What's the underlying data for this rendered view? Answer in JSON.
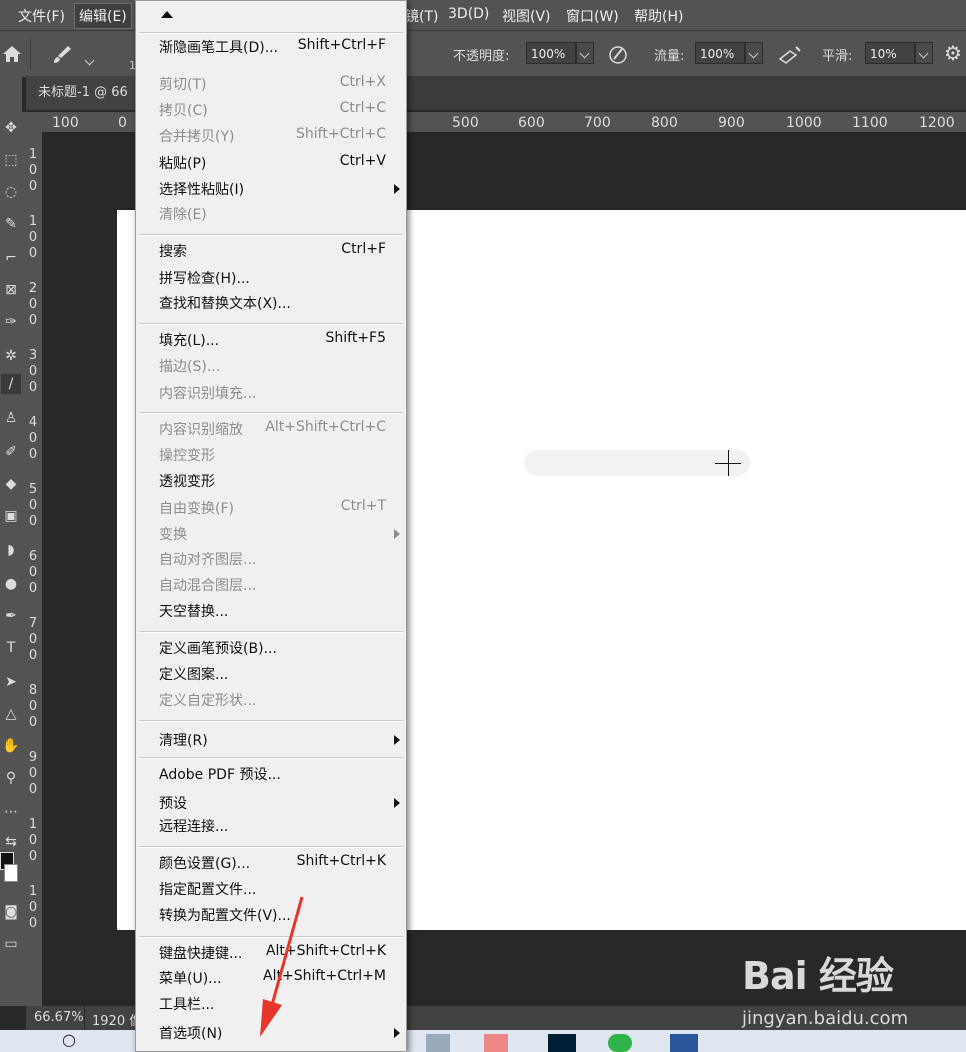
{
  "menubar": {
    "items": [
      "文件(F)",
      "编辑(E)",
      "镜(T)",
      "3D(D)",
      "视图(V)",
      "窗口(W)",
      "帮助(H)"
    ]
  },
  "options": {
    "opacity_label": "不透明度:",
    "opacity_value": "100%",
    "flow_label": "流量:",
    "flow_value": "100%",
    "smooth_label": "平滑:",
    "smooth_value": "10%",
    "brush_size": "1"
  },
  "document": {
    "tab_title": "未标题-1 @ 66"
  },
  "ruler": {
    "h_labels": [
      "100",
      "0",
      "500",
      "600",
      "700",
      "800",
      "900",
      "1000",
      "1100",
      "1200"
    ],
    "v_labels": [
      "1",
      "0",
      "0",
      "1",
      "0",
      "0",
      "2",
      "0",
      "0",
      "3",
      "0",
      "0",
      "4",
      "0",
      "0",
      "5",
      "0",
      "0",
      "6",
      "0",
      "0",
      "7",
      "0",
      "0",
      "8",
      "0",
      "0",
      "9",
      "0",
      "0",
      "1",
      "0",
      "0",
      "1",
      "0",
      "0"
    ]
  },
  "status": {
    "zoom": "66.67%",
    "size": "1920 像"
  },
  "menu": {
    "items": [
      {
        "label": "渐隐画笔工具(D)...",
        "shortcut": "Shift+Ctrl+F",
        "disabled": false
      },
      {
        "label": "剪切(T)",
        "shortcut": "Ctrl+X",
        "disabled": true
      },
      {
        "label": "拷贝(C)",
        "shortcut": "Ctrl+C",
        "disabled": true
      },
      {
        "label": "合并拷贝(Y)",
        "shortcut": "Shift+Ctrl+C",
        "disabled": true
      },
      {
        "label": "粘贴(P)",
        "shortcut": "Ctrl+V",
        "disabled": false
      },
      {
        "label": "选择性粘贴(I)",
        "shortcut": "",
        "disabled": false
      },
      {
        "label": "清除(E)",
        "shortcut": "",
        "disabled": true
      },
      {
        "label": "搜索",
        "shortcut": "Ctrl+F",
        "disabled": false
      },
      {
        "label": "拼写检查(H)...",
        "shortcut": "",
        "disabled": false
      },
      {
        "label": "查找和替换文本(X)...",
        "shortcut": "",
        "disabled": false
      },
      {
        "label": "填充(L)...",
        "shortcut": "Shift+F5",
        "disabled": false
      },
      {
        "label": "描边(S)...",
        "shortcut": "",
        "disabled": true
      },
      {
        "label": "内容识别填充...",
        "shortcut": "",
        "disabled": true
      },
      {
        "label": "内容识别缩放",
        "shortcut": "Alt+Shift+Ctrl+C",
        "disabled": true
      },
      {
        "label": "操控变形",
        "shortcut": "",
        "disabled": true
      },
      {
        "label": "透视变形",
        "shortcut": "",
        "disabled": false
      },
      {
        "label": "自由变换(F)",
        "shortcut": "Ctrl+T",
        "disabled": true
      },
      {
        "label": "变换",
        "shortcut": "",
        "disabled": true
      },
      {
        "label": "自动对齐图层...",
        "shortcut": "",
        "disabled": true
      },
      {
        "label": "自动混合图层...",
        "shortcut": "",
        "disabled": true
      },
      {
        "label": "天空替换...",
        "shortcut": "",
        "disabled": false
      },
      {
        "label": "定义画笔预设(B)...",
        "shortcut": "",
        "disabled": false
      },
      {
        "label": "定义图案...",
        "shortcut": "",
        "disabled": false
      },
      {
        "label": "定义自定形状...",
        "shortcut": "",
        "disabled": true
      },
      {
        "label": "清理(R)",
        "shortcut": "",
        "disabled": false
      },
      {
        "label": "Adobe PDF 预设...",
        "shortcut": "",
        "disabled": false
      },
      {
        "label": "预设",
        "shortcut": "",
        "disabled": false
      },
      {
        "label": "远程连接...",
        "shortcut": "",
        "disabled": false
      },
      {
        "label": "颜色设置(G)...",
        "shortcut": "Shift+Ctrl+K",
        "disabled": false
      },
      {
        "label": "指定配置文件...",
        "shortcut": "",
        "disabled": false
      },
      {
        "label": "转换为配置文件(V)...",
        "shortcut": "",
        "disabled": false
      },
      {
        "label": "键盘快捷键...",
        "shortcut": "Alt+Shift+Ctrl+K",
        "disabled": false
      },
      {
        "label": "菜单(U)...",
        "shortcut": "Alt+Shift+Ctrl+M",
        "disabled": false
      },
      {
        "label": "工具栏...",
        "shortcut": "",
        "disabled": false
      },
      {
        "label": "首选项(N)",
        "shortcut": "",
        "disabled": false
      }
    ]
  },
  "watermark": {
    "logo": "Bai 经验",
    "url": "jingyan.baidu.com"
  },
  "colors": {
    "accent": "#e8352a",
    "menu_bg": "#f0f0f0",
    "ui_bg": "#535353"
  }
}
